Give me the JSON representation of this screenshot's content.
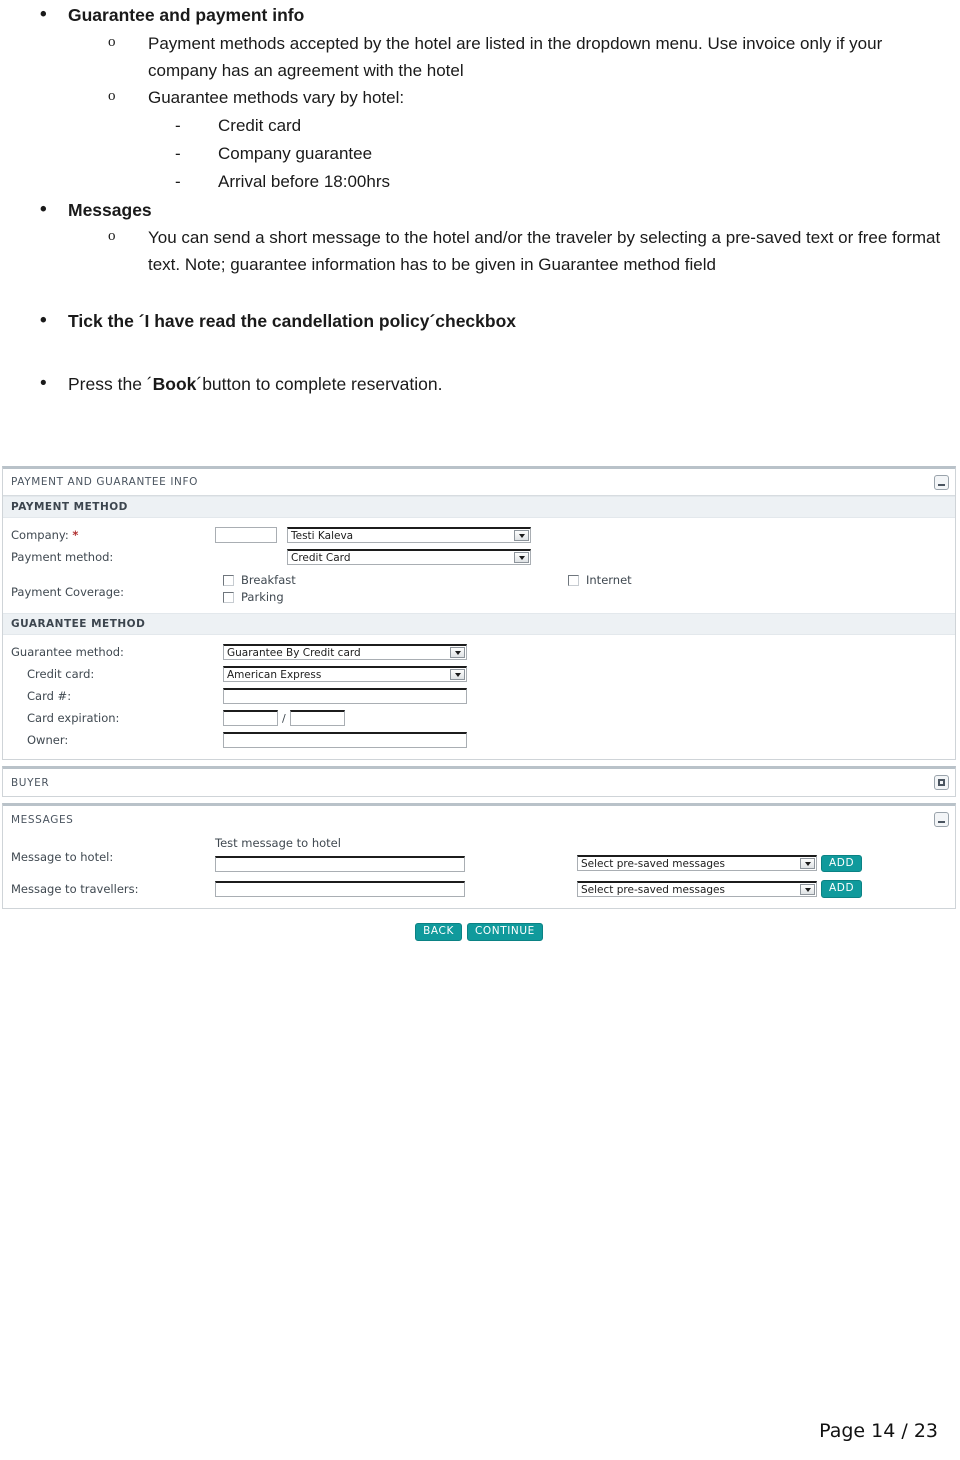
{
  "document": {
    "bullets": [
      {
        "level": 1,
        "marker": "•",
        "bold": true,
        "text": "Guarantee and payment info"
      },
      {
        "level": 2,
        "marker": "o",
        "bold": false,
        "text": "Payment methods accepted by the hotel are listed in the dropdown menu.  Use invoice only if your company has an agreement with the hotel"
      },
      {
        "level": 2,
        "marker": "o",
        "bold": false,
        "text": "Guarantee methods vary by hotel:"
      },
      {
        "level": 3,
        "marker": "-",
        "bold": false,
        "text": "Credit card"
      },
      {
        "level": 3,
        "marker": "-",
        "bold": false,
        "text": "Company guarantee"
      },
      {
        "level": 3,
        "marker": "-",
        "bold": false,
        "text": "Arrival before 18:00hrs"
      },
      {
        "level": 1,
        "marker": "•",
        "bold": true,
        "text": "Messages"
      },
      {
        "level": 2,
        "marker": "o",
        "bold": false,
        "text": "You can send a short message to the hotel and/or the traveler by selecting a pre-saved text or free format text.  Note; guarantee information has to be given in Guarantee method field"
      }
    ],
    "tick_line_prefix": "Tick the ´I have read the candellation policy´checkbox",
    "press_line_pre": "Press the ´",
    "press_line_bold": "Book",
    "press_line_post": "´button to complete reservation.",
    "page_footer": "Page 14 / 23"
  },
  "app": {
    "payment_panel": {
      "title": "PAYMENT AND GUARANTEE INFO",
      "collapse_icon": "minimize-icon",
      "payment_method_section": {
        "heading": "PAYMENT METHOD",
        "company_label": "Company:",
        "company_required_mark": "*",
        "company_code_value": "",
        "company_select_value": "Testi Kaleva",
        "payment_method_label": "Payment method:",
        "payment_method_value": "Credit Card",
        "coverage_label": "Payment Coverage:",
        "coverage_options": [
          {
            "label": "Breakfast",
            "checked": false
          },
          {
            "label": "Parking",
            "checked": false
          },
          {
            "label": "Internet",
            "checked": false
          }
        ]
      },
      "guarantee_method_section": {
        "heading": "GUARANTEE METHOD",
        "guarantee_method_label": "Guarantee method:",
        "guarantee_method_value": "Guarantee By Credit card",
        "credit_card_label": "Credit card:",
        "credit_card_value": "American Express",
        "card_number_label": "Card #:",
        "card_number_value": "",
        "card_expiration_label": "Card expiration:",
        "card_expiration_month": "",
        "card_expiration_separator": "/",
        "card_expiration_year": "",
        "owner_label": "Owner:",
        "owner_value": ""
      }
    },
    "buyer_panel": {
      "title": "BUYER",
      "restore_icon": "restore-icon"
    },
    "messages_panel": {
      "title": "MESSAGES",
      "collapse_icon": "minimize-icon",
      "hotel_label": "Message to hotel:",
      "hotel_note": "Test message to hotel",
      "hotel_value": "",
      "hotel_presaved_value": "Select pre-saved messages",
      "hotel_add_label": "ADD",
      "travellers_label": "Message to travellers:",
      "travellers_value": "",
      "travellers_presaved_value": "Select pre-saved messages",
      "travellers_add_label": "ADD"
    },
    "actions": {
      "back_label": "BACK",
      "continue_label": "CONTINUE"
    },
    "colors": {
      "teal": "#109a9c",
      "section_header_bg": "#edf1f4",
      "panel_border": "#cfd4d8",
      "required_star": "#b03030"
    }
  }
}
